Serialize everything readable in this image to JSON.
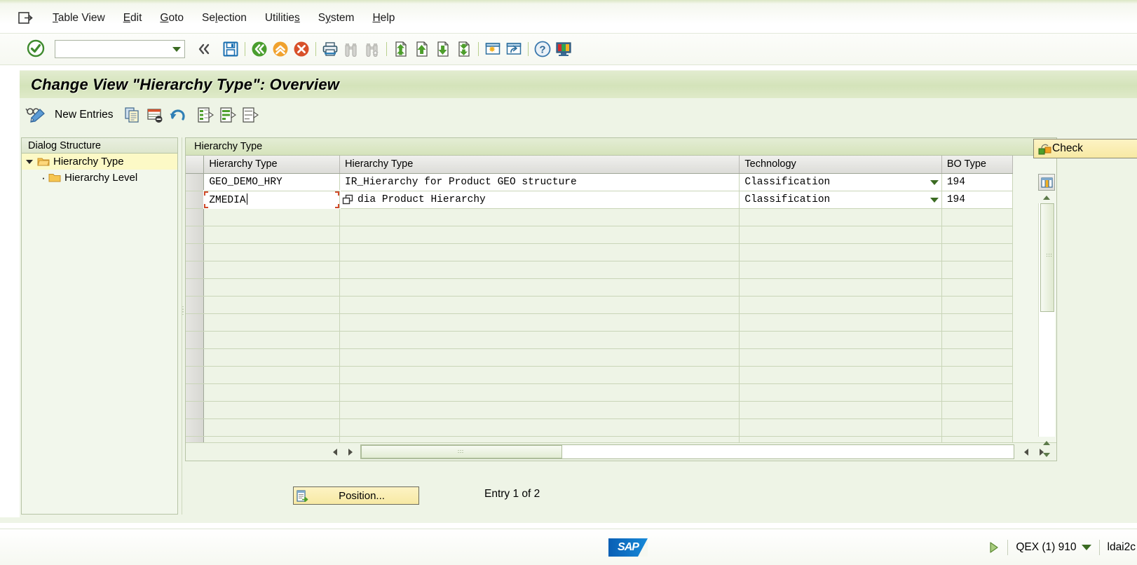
{
  "window": {
    "title": "Change View \"Hierarchy Type\": Overview",
    "system_icon": "session-icon"
  },
  "menubar": {
    "items": [
      {
        "label": "Table View",
        "accel": "T",
        "name": "menu-table-view"
      },
      {
        "label": "Edit",
        "accel": "E",
        "name": "menu-edit"
      },
      {
        "label": "Goto",
        "accel": "G",
        "name": "menu-goto"
      },
      {
        "label": "Selection",
        "accel": "l",
        "name": "menu-selection"
      },
      {
        "label": "Utilities",
        "accel": "s",
        "name": "menu-utilities"
      },
      {
        "label": "System",
        "accel": "y",
        "name": "menu-system"
      },
      {
        "label": "Help",
        "accel": "H",
        "name": "menu-help"
      }
    ]
  },
  "toolbar": {
    "enter_tooltip": "Continue (Enter)",
    "command_value": "",
    "command_placeholder": "",
    "buttons": [
      {
        "name": "back-button",
        "icon": "back-chevrons-icon",
        "tooltip": "Back"
      },
      {
        "name": "save-button",
        "icon": "save-floppy-icon",
        "tooltip": "Save"
      },
      {
        "name": "exit-button",
        "icon": "green-back-icon",
        "tooltip": "Back"
      },
      {
        "name": "end-transaction-button",
        "icon": "orange-up-icon",
        "tooltip": "Exit"
      },
      {
        "name": "cancel-button",
        "icon": "red-cancel-icon",
        "tooltip": "Cancel"
      },
      {
        "name": "print-button",
        "icon": "printer-icon",
        "tooltip": "Print"
      },
      {
        "name": "find-button",
        "icon": "binoculars-icon",
        "tooltip": "Find"
      },
      {
        "name": "find-next-button",
        "icon": "binoculars-plus-icon",
        "tooltip": "Find Next"
      },
      {
        "name": "first-page-button",
        "icon": "first-page-icon",
        "tooltip": "First Page"
      },
      {
        "name": "previous-page-button",
        "icon": "previous-page-icon",
        "tooltip": "Previous Page"
      },
      {
        "name": "next-page-button",
        "icon": "next-page-icon",
        "tooltip": "Next Page"
      },
      {
        "name": "last-page-button",
        "icon": "last-page-icon",
        "tooltip": "Last Page"
      },
      {
        "name": "create-session-button",
        "icon": "new-session-icon",
        "tooltip": "Create New Session"
      },
      {
        "name": "create-shortcut-button",
        "icon": "shortcut-icon",
        "tooltip": "Create Shortcut"
      },
      {
        "name": "help-button",
        "icon": "question-help-icon",
        "tooltip": "Help"
      },
      {
        "name": "customize-button",
        "icon": "customize-layout-icon",
        "tooltip": "Customize Local Layout"
      }
    ]
  },
  "apptoolbar": {
    "new_entries_label": "New Entries",
    "buttons": [
      {
        "name": "display-change-button",
        "icon": "glasses-pencil-icon"
      },
      {
        "name": "copy-as-button",
        "icon": "copy-document-icon"
      },
      {
        "name": "delete-button",
        "icon": "delete-row-icon"
      },
      {
        "name": "undo-button",
        "icon": "undo-arrow-icon"
      },
      {
        "name": "select-all-button",
        "icon": "select-all-list-icon"
      },
      {
        "name": "select-block-button",
        "icon": "select-block-list-icon"
      },
      {
        "name": "deselect-all-button",
        "icon": "deselect-list-icon"
      }
    ]
  },
  "check_button": {
    "label": "Check",
    "icon": "check-consistency-icon"
  },
  "dialog_structure": {
    "header": "Dialog Structure",
    "nodes": [
      {
        "label": "Hierarchy Type",
        "level": 0,
        "expanded": true,
        "selected": true,
        "icon": "open-folder-icon"
      },
      {
        "label": "Hierarchy Level",
        "level": 1,
        "expanded": false,
        "selected": false,
        "icon": "closed-folder-icon"
      }
    ]
  },
  "table": {
    "group_header": "Hierarchy Type",
    "columns": [
      {
        "key": "sel",
        "label": ""
      },
      {
        "key": "hier_key",
        "label": "Hierarchy Type"
      },
      {
        "key": "hier_desc",
        "label": "Hierarchy Type"
      },
      {
        "key": "technology",
        "label": "Technology"
      },
      {
        "key": "bo_type",
        "label": "BO Type"
      }
    ],
    "rows": [
      {
        "hier_key": "GEO_DEMO_HRY",
        "hier_desc": "IR_Hierarchy for Product GEO structure",
        "technology": "Classification",
        "bo_type": "194",
        "focused": false
      },
      {
        "hier_key": "ZMEDIA",
        "hier_desc": "dia Product Hierarchy",
        "technology": "Classification",
        "bo_type": "194",
        "focused": true,
        "drag_cursor_icon": "copy-drag-cursor-icon"
      }
    ],
    "empty_row_count": 14,
    "column_config_icon": "table-settings-icon"
  },
  "footer": {
    "position_button_label": "Position...",
    "position_button_icon": "position-jump-icon",
    "entry_counter": "Entry 1 of 2"
  },
  "statusbar": {
    "logo_text": "SAP",
    "ready_icon": "green-play-icon",
    "system": "QEX (1) 910",
    "server": "ldai2c"
  },
  "colors": {
    "accent_green": "#6b9c31",
    "title_band": "#d4e3ba",
    "page_bg": "#eef4e6",
    "selection_yellow": "#fcf9c6",
    "button_yellow": "#f7e9a4",
    "focus_red": "#d04a2a",
    "sap_blue": "#0a5fb4"
  }
}
